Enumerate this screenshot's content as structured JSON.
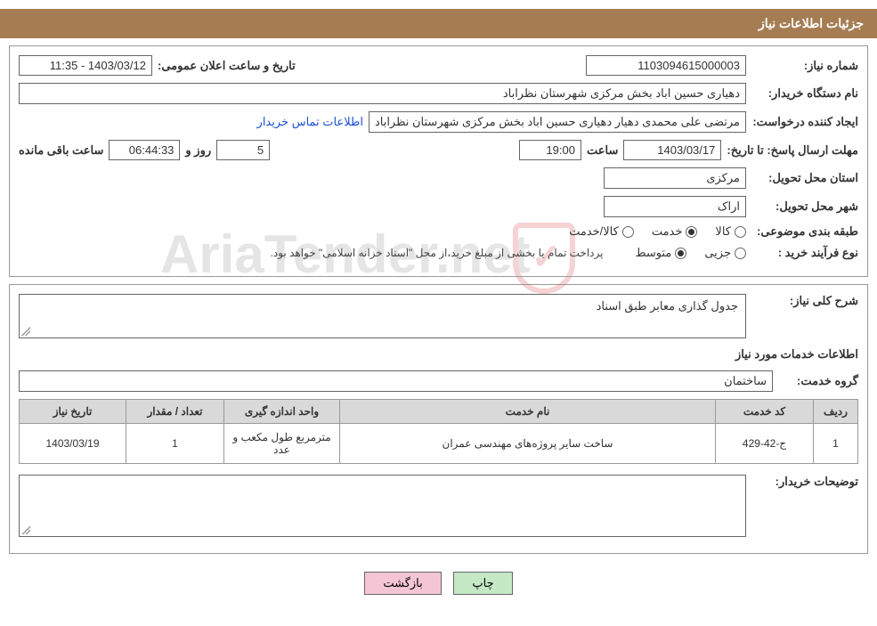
{
  "header": {
    "title": "جزئیات اطلاعات نیاز"
  },
  "form": {
    "need_number_label": "شماره نیاز:",
    "need_number": "1103094615000003",
    "announce_date_label": "تاریخ و ساعت اعلان عمومی:",
    "announce_date": "1403/03/12 - 11:35",
    "buyer_org_label": "نام دستگاه خریدار:",
    "buyer_org": "دهیاری حسین اباد بخش مرکزی شهرستان نظراباد",
    "requester_label": "ایجاد کننده درخواست:",
    "requester": "مرتضی علی محمدی دهیار دهیاری حسین اباد بخش مرکزی شهرستان نظراباد",
    "contact_link": "اطلاعات تماس خریدار",
    "deadline_label": "مهلت ارسال پاسخ: تا تاریخ:",
    "deadline_date": "1403/03/17",
    "time_label": "ساعت",
    "deadline_time": "19:00",
    "days": "5",
    "days_label": "روز و",
    "countdown": "06:44:33",
    "remaining_label": "ساعت باقی مانده",
    "delivery_province_label": "استان محل تحویل:",
    "delivery_province": "مرکزی",
    "delivery_city_label": "شهر محل تحویل:",
    "delivery_city": "اراک",
    "category_label": "طبقه بندی موضوعی:",
    "cat_goods": "کالا",
    "cat_service": "خدمت",
    "cat_goods_service": "کالا/خدمت",
    "process_label": "نوع فرآیند خرید :",
    "proc_small": "جزیی",
    "proc_medium": "متوسط",
    "payment_note": "پرداخت تمام یا بخشی از مبلغ خرید،از محل \"اسناد خزانه اسلامی\" خواهد بود."
  },
  "details": {
    "summary_label": "شرح کلی نیاز:",
    "summary": "جدول گذاری معابر طبق اسناد",
    "services_title": "اطلاعات خدمات مورد نیاز",
    "service_group_label": "گروه خدمت:",
    "service_group": "ساختمان",
    "table": {
      "headers": {
        "row": "ردیف",
        "code": "کد خدمت",
        "name": "نام خدمت",
        "unit": "واحد اندازه گیری",
        "qty": "تعداد / مقدار",
        "date": "تاریخ نیاز"
      },
      "rows": [
        {
          "row": "1",
          "code": "ج-42-429",
          "name": "ساخت سایر پروژه‌های مهندسی عمران",
          "unit": "مترمربع طول مکعب و عدد",
          "qty": "1",
          "date": "1403/03/19"
        }
      ]
    },
    "buyer_notes_label": "توضیحات خریدار:"
  },
  "buttons": {
    "print": "چاپ",
    "back": "بازگشت"
  },
  "watermark": "AriaTender.net"
}
